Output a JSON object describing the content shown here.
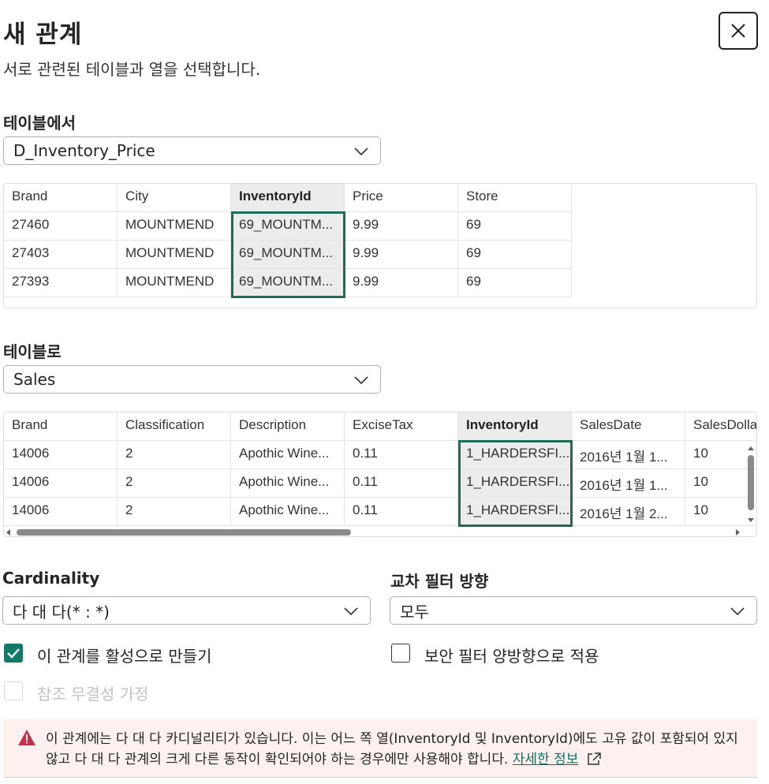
{
  "dialog": {
    "title": "새 관계",
    "subtitle": "서로 관련된 테이블과 열을 선택합니다.",
    "close_icon": "close-icon"
  },
  "from_section": {
    "label": "테이블에서",
    "table_value": "D_Inventory_Price",
    "columns": [
      "Brand",
      "City",
      "InventoryId",
      "Price",
      "Store"
    ],
    "selected_column": "InventoryId",
    "rows": [
      [
        "27460",
        "MOUNTMEND",
        "69_MOUNTM...",
        "9.99",
        "69"
      ],
      [
        "27403",
        "MOUNTMEND",
        "69_MOUNTM...",
        "9.99",
        "69"
      ],
      [
        "27393",
        "MOUNTMEND",
        "69_MOUNTM...",
        "9.99",
        "69"
      ]
    ]
  },
  "to_section": {
    "label": "테이블로",
    "table_value": "Sales",
    "columns": [
      "Brand",
      "Classification",
      "Description",
      "ExciseTax",
      "InventoryId",
      "SalesDate",
      "SalesDolla"
    ],
    "selected_column": "InventoryId",
    "rows": [
      [
        "14006",
        "2",
        "Apothic Wine...",
        "0.11",
        "1_HARDERSFI...",
        "2016년 1월 1...",
        "10"
      ],
      [
        "14006",
        "2",
        "Apothic Wine...",
        "0.11",
        "1_HARDERSFI...",
        "2016년 1월 1...",
        "10"
      ],
      [
        "14006",
        "2",
        "Apothic Wine...",
        "0.11",
        "1_HARDERSFI...",
        "2016년 1월 2...",
        "10"
      ]
    ]
  },
  "cardinality": {
    "label": "Cardinality",
    "value": "다 대 다(* : *)"
  },
  "cross_filter": {
    "label": "교차 필터 방향",
    "value": "모두"
  },
  "options": {
    "make_active": {
      "label": "이 관계를 활성으로 만들기",
      "checked": true
    },
    "bidirectional_security": {
      "label": "보안 필터 양방향으로 적용",
      "checked": false
    },
    "referential_integrity": {
      "label": "참조 무결성 가정",
      "checked": false,
      "disabled": true
    }
  },
  "warning": {
    "icon": "warning-icon",
    "text": "이 관계에는 다 대 다 카디널리티가 있습니다. 이는 어느 쪽 열(InventoryId 및 InventoryId)에도 고유 값이 포함되어 있지 않고 다 대 다 관계의 크게 다른 동작이 확인되어야 하는 경우에만 사용해야 합니다.",
    "link_text": "자세한 정보",
    "link_icon": "external-link-icon"
  },
  "colors": {
    "accent": "#127a68",
    "selection_border": "#1e6b5a",
    "warning_bg": "#fdf1f0",
    "warning_icon": "#c4314b"
  }
}
